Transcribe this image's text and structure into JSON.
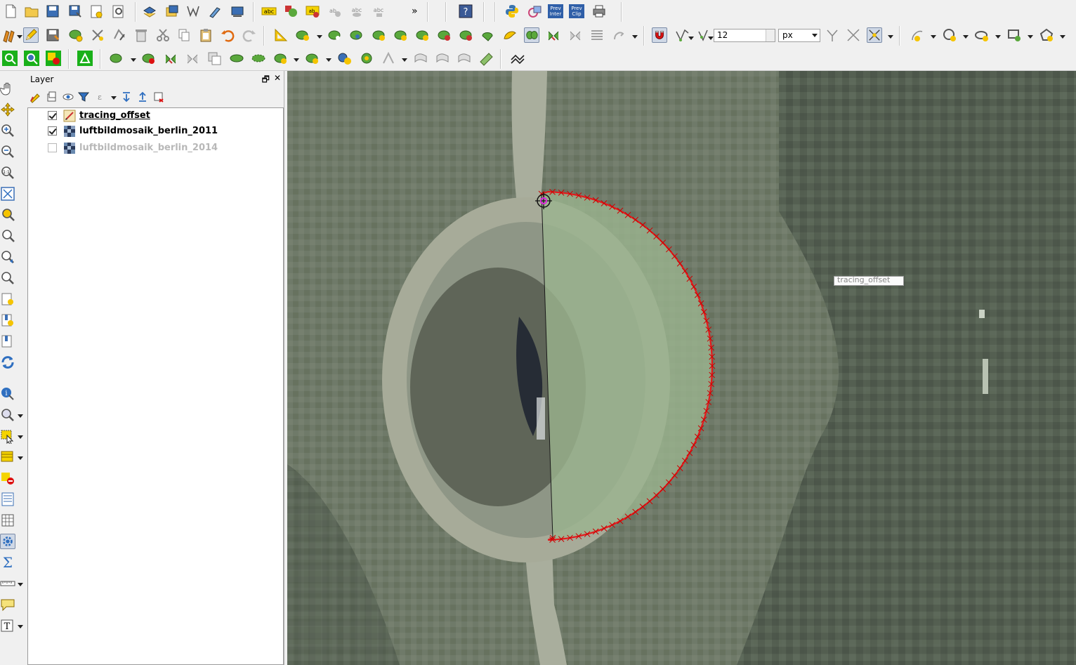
{
  "toolbar": {
    "digitize": {
      "snap_tolerance_value": "12",
      "snap_units": "px"
    },
    "labels": {
      "abc": "abc",
      "prev_inter": "Prev\nInter",
      "prev_clip": "Prev\nClip",
      "help": "?"
    },
    "overflow": "»"
  },
  "layers_panel": {
    "title": "Layer",
    "float_button": "🗗",
    "close_button": "✕",
    "items": [
      {
        "name": "tracing_offset",
        "checked": true,
        "type": "vector-line"
      },
      {
        "name": "luftbildmosaik_berlin_2011",
        "checked": true,
        "type": "raster"
      },
      {
        "name": "luftbildmosaik_berlin_2014",
        "checked": false,
        "type": "raster"
      }
    ]
  },
  "map": {
    "tooltip_text": "tracing_offset",
    "colors": {
      "trace_line": "#e31a1c",
      "vertex_marker": "#cc0000",
      "snap_cursor": "#e020e0",
      "fill": "#9bb48f"
    }
  },
  "colors": {
    "toolbar_bg": "#f0f0f0",
    "accent_yellow": "#f5c400",
    "accent_green": "#5aa83c",
    "accent_blue": "#2f6fc0"
  }
}
